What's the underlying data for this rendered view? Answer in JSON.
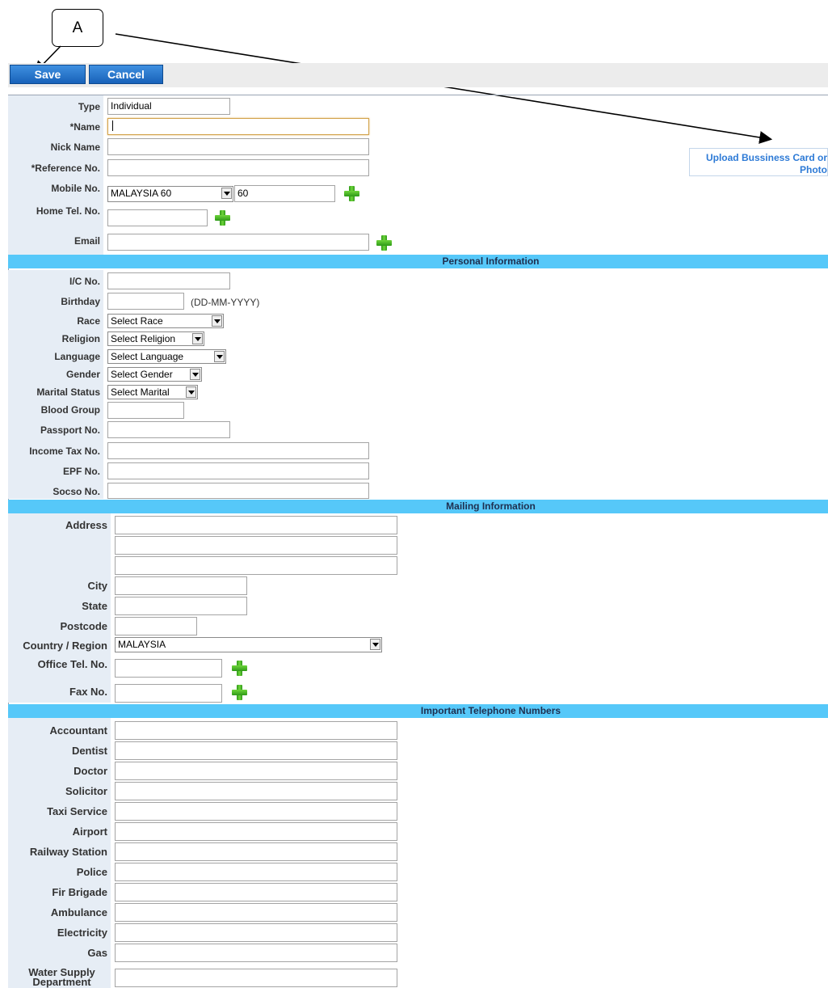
{
  "annotation": {
    "label": "A"
  },
  "toolbar": {
    "save_label": "Save",
    "cancel_label": "Cancel"
  },
  "upload": {
    "line1": "Upload Bussiness Card or",
    "line2": "Photo"
  },
  "basic": {
    "type_label": "Type",
    "type_value": "Individual",
    "name_label": "*Name",
    "nick_label": "Nick Name",
    "ref_label": "*Reference No.",
    "mobile_label": "Mobile No.",
    "mobile_country": "MALAYSIA 60",
    "mobile_code": "60",
    "home_label": "Home Tel. No.",
    "email_label": "Email"
  },
  "personal": {
    "title": "Personal Information",
    "ic_label": "I/C No.",
    "birthday_label": "Birthday",
    "birthday_hint": "(DD-MM-YYYY)",
    "race_label": "Race",
    "race_value": "Select Race",
    "religion_label": "Religion",
    "religion_value": "Select Religion",
    "language_label": "Language",
    "language_value": "Select Language",
    "gender_label": "Gender",
    "gender_value": "Select Gender",
    "marital_label": "Marital Status",
    "marital_value": "Select Marital",
    "blood_label": "Blood Group",
    "passport_label": "Passport No.",
    "tax_label": "Income Tax No.",
    "epf_label": "EPF No.",
    "socso_label": "Socso No."
  },
  "mailing": {
    "title": "Mailing Information",
    "address_label": "Address",
    "city_label": "City",
    "state_label": "State",
    "postcode_label": "Postcode",
    "country_label": "Country / Region",
    "country_value": "MALAYSIA",
    "office_label": "Office Tel. No.",
    "fax_label": "Fax No."
  },
  "phones": {
    "title": "Important Telephone Numbers",
    "accountant": "Accountant",
    "dentist": "Dentist",
    "doctor": "Doctor",
    "solicitor": "Solicitor",
    "taxi": "Taxi Service",
    "airport": "Airport",
    "railway": "Railway Station",
    "police": "Police",
    "fire": "Fir Brigade",
    "ambulance": "Ambulance",
    "electricity": "Electricity",
    "gas": "Gas",
    "water1": "Water Supply",
    "water2": "Department"
  }
}
